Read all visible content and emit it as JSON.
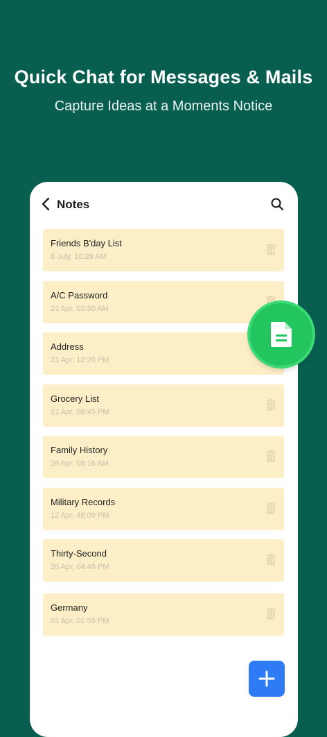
{
  "hero": {
    "title": "Quick Chat for Messages & Mails",
    "subtitle": "Capture Ideas at a Moments Notice"
  },
  "appbar": {
    "title": "Notes",
    "back_icon": "chevron-left-icon",
    "search_icon": "search-icon"
  },
  "notes": [
    {
      "title": "Friends B'day List",
      "date": "8 July, 10:28 AM"
    },
    {
      "title": "A/C Password",
      "date": "21 Apr, 02:50 AM"
    },
    {
      "title": "Address",
      "date": "21 Apr, 12:20 PM"
    },
    {
      "title": "Grocery List",
      "date": "21 Apr, 08:45 PM"
    },
    {
      "title": "Family History",
      "date": "26 Apr, 08:16 AM"
    },
    {
      "title": "Military Records",
      "date": "12 Apr, 48:09 PM"
    },
    {
      "title": "Thirty-Second",
      "date": "26 Apr, 04:48 PM"
    },
    {
      "title": "Germany",
      "date": "01 Apr, 01:59 PM"
    }
  ],
  "colors": {
    "background": "#085F50",
    "note_card": "#FCEFC7",
    "fab": "#2F7BF6",
    "badge": "#22C55E"
  },
  "icons": {
    "fab": "plus-icon",
    "badge": "document-icon",
    "note_action": "trash-icon"
  }
}
